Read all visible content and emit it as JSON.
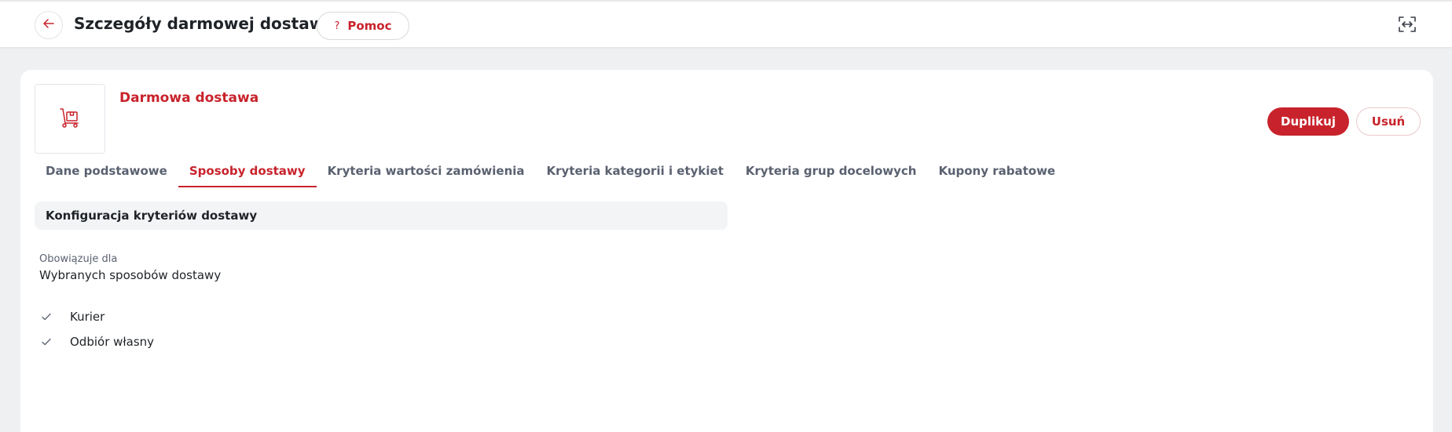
{
  "header": {
    "title": "Szczegóły darmowej dostawy",
    "help_label": "Pomoc",
    "help_icon": "?"
  },
  "offer": {
    "name": "Darmowa dostawa",
    "icon": "delivery-trolley-icon"
  },
  "actions": {
    "duplicate_label": "Duplikuj",
    "delete_label": "Usuń"
  },
  "tabs": [
    {
      "label": "Dane podstawowe",
      "active": false
    },
    {
      "label": "Sposoby dostawy",
      "active": true
    },
    {
      "label": "Kryteria wartości zamówienia",
      "active": false
    },
    {
      "label": "Kryteria kategorii i etykiet",
      "active": false
    },
    {
      "label": "Kryteria grup docelowych",
      "active": false
    },
    {
      "label": "Kupony rabatowe",
      "active": false
    }
  ],
  "section": {
    "title": "Konfiguracja kryteriów dostawy",
    "applies_label": "Obowiązuje dla",
    "applies_value": "Wybranych sposobów dostawy",
    "methods": [
      "Kurier",
      "Odbiór własny"
    ]
  },
  "colors": {
    "accent": "#c8232c",
    "background": "#eff0f2",
    "card": "#ffffff",
    "section_bg": "#f3f4f6"
  }
}
